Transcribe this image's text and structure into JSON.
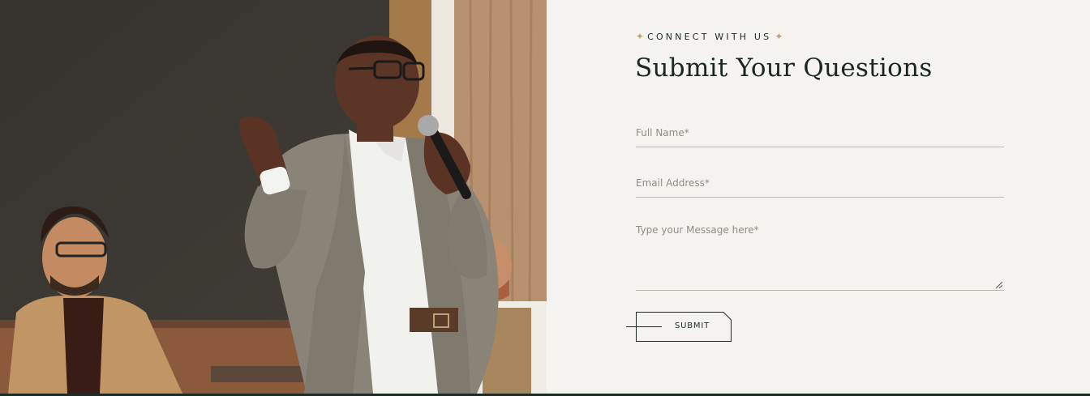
{
  "photo": {
    "alt": "Man in grey suit speaking into a microphone at a conference"
  },
  "contact": {
    "eyebrow": "CONNECT WITH US",
    "sparkle_icon": "sparkle-icon",
    "title": "Submit Your Questions",
    "fields": {
      "full_name_placeholder": "Full Name*",
      "email_placeholder": "Email Address*",
      "message_placeholder": "Type your Message here*"
    },
    "submit_label": "SUBMIT"
  },
  "colors": {
    "background": "#f4f3ef",
    "text": "#1b2622",
    "accent": "#c2a176",
    "footer": "#1c2b25"
  }
}
